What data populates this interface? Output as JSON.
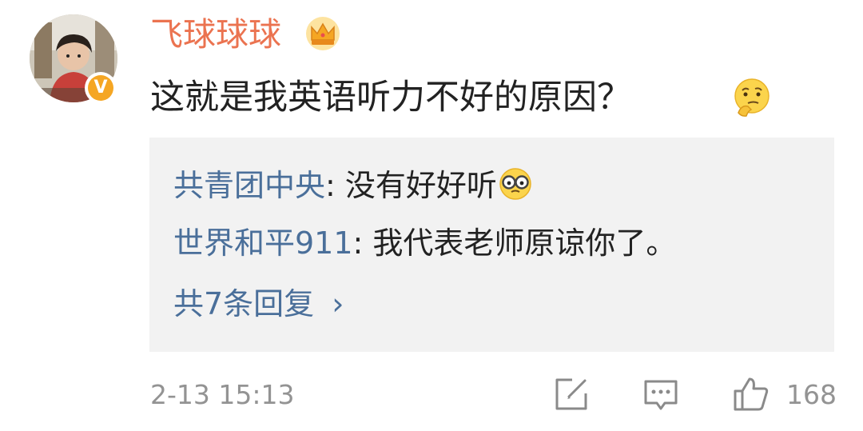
{
  "post": {
    "username": "飞球球球",
    "text": "这就是我英语听力不好的原因？",
    "timestamp": "2-13 15:13",
    "likes": "168"
  },
  "badges": {
    "verified_glyph": "V",
    "verified_color": "#f5a623",
    "crown_icon": "crown-icon"
  },
  "replies": [
    {
      "name": "共青团中央",
      "separator": ": ",
      "text": "没有好好听",
      "emoji": "nerd-glasses-emoji"
    },
    {
      "name": "世界和平911",
      "separator": ": ",
      "text": "我代表老师原谅你了。"
    }
  ],
  "more_replies": {
    "label": "共7条回复",
    "chevron": "›"
  },
  "colors": {
    "username": "#eb7350",
    "link": "#4a6f9a",
    "meta": "#939393",
    "reply_bg": "#f2f2f2"
  }
}
